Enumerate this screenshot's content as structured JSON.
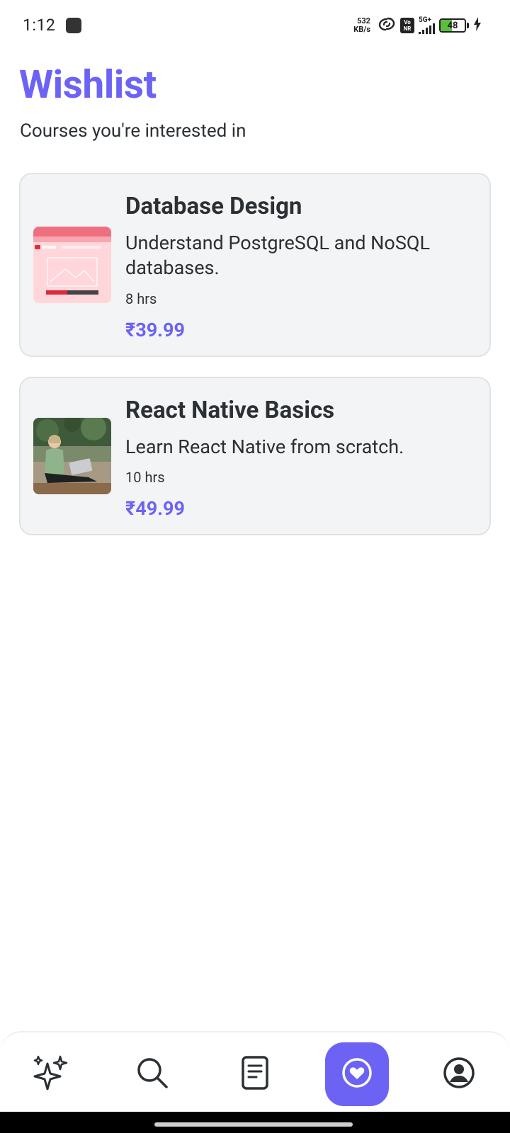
{
  "status_bar": {
    "time": "1:12",
    "net_speed_value": "532",
    "net_speed_unit": "KB/s",
    "volte_top": "Vo",
    "volte_bottom": "NR",
    "network": "5G+",
    "battery_level": "48",
    "battery_fraction": 0.48
  },
  "header": {
    "title": "Wishlist",
    "subtitle": "Courses you're interested in"
  },
  "courses": [
    {
      "title": "Database Design",
      "description": "Understand PostgreSQL and NoSQL databases.",
      "duration": "8 hrs",
      "price": "₹39.99"
    },
    {
      "title": "React Native Basics",
      "description": "Learn React Native from scratch.",
      "duration": "10 hrs",
      "price": "₹49.99"
    }
  ],
  "nav": {
    "items": [
      {
        "icon": "sparkles-icon",
        "active": false
      },
      {
        "icon": "search-icon",
        "active": false
      },
      {
        "icon": "document-icon",
        "active": false
      },
      {
        "icon": "heart-icon",
        "active": true
      },
      {
        "icon": "profile-icon",
        "active": false
      }
    ]
  },
  "colors": {
    "accent": "#6c63f5",
    "card_bg": "#f3f4f6",
    "text": "#2b3034"
  }
}
